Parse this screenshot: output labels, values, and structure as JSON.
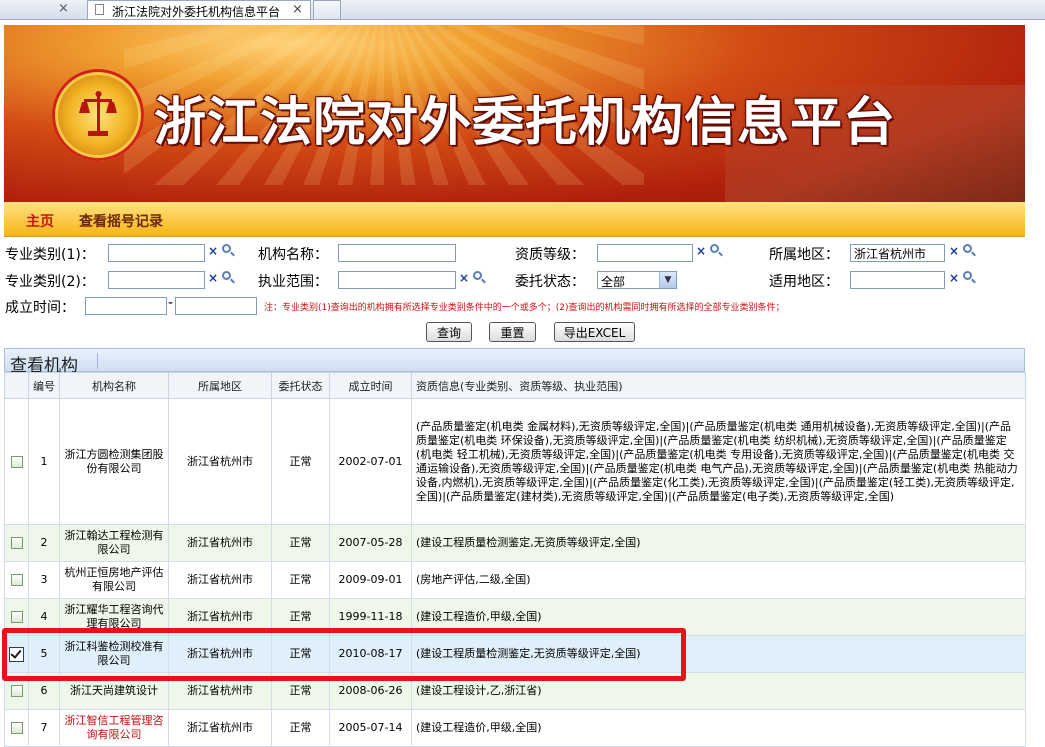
{
  "browser": {
    "tab_title": "浙江法院对外委托机构信息平台",
    "close_glyph": "×"
  },
  "banner": {
    "title": "浙江法院对外委托机构信息平台"
  },
  "nav": {
    "home": "主页",
    "lottery_log": "查看摇号记录"
  },
  "search": {
    "spec1_label": "专业类别(1)：",
    "spec2_label": "专业类别(2)：",
    "founded_label": "成立时间：",
    "founded_dash": "-",
    "name_label": "机构名称：",
    "scope_label": "执业范围：",
    "qual_label": "资质等级：",
    "status_label": "委托状态：",
    "status_value": "全部",
    "region_label": "所属地区：",
    "region_value": "浙江省杭州市",
    "apply_region_label": "适用地区：",
    "clear_glyph": "×",
    "note": "注：专业类别(1)查询出的机构拥有所选择专业类别条件中的一个或多个；(2)查询出的机构需同时拥有所选择的全部专业类别条件；",
    "query_btn": "查询",
    "reset_btn": "重置",
    "export_btn": "导出EXCEL"
  },
  "results": {
    "panel_title": "查看机构",
    "columns": [
      "编号",
      "机构名称",
      "所属地区",
      "委托状态",
      "成立时间",
      "资质信息(专业类别、资质等级、执业范围)"
    ],
    "rows": [
      {
        "no": "1",
        "name": "浙江方圆检测集团股份有限公司",
        "region": "浙江省杭州市",
        "status": "正常",
        "date": "2002-07-01",
        "qual": "(产品质量鉴定(机电类 金属材料),无资质等级评定,全国)|(产品质量鉴定(机电类 通用机械设备),无资质等级评定,全国)|(产品质量鉴定(机电类 环保设备),无资质等级评定,全国)|(产品质量鉴定(机电类 纺织机械),无资质等级评定,全国)|(产品质量鉴定(机电类 轻工机械),无资质等级评定,全国)|(产品质量鉴定(机电类 专用设备),无资质等级评定,全国)|(产品质量鉴定(机电类 交通运输设备),无资质等级评定,全国)|(产品质量鉴定(机电类 电气产品),无资质等级评定,全国)|(产品质量鉴定(机电类 热能动力设备,内燃机),无资质等级评定,全国)|(产品质量鉴定(化工类),无资质等级评定,全国)|(产品质量鉴定(轻工类),无资质等级评定,全国)|(产品质量鉴定(建材类),无资质等级评定,全国)|(产品质量鉴定(电子类),无资质等级评定,全国)"
      },
      {
        "no": "2",
        "name": "浙江翰达工程检测有限公司",
        "region": "浙江省杭州市",
        "status": "正常",
        "date": "2007-05-28",
        "qual": "(建设工程质量检测鉴定,无资质等级评定,全国)"
      },
      {
        "no": "3",
        "name": "杭州正恒房地产评估有限公司",
        "region": "浙江省杭州市",
        "status": "正常",
        "date": "2009-09-01",
        "qual": "(房地产评估,二级,全国)"
      },
      {
        "no": "4",
        "name": "浙江耀华工程咨询代理有限公司",
        "region": "浙江省杭州市",
        "status": "正常",
        "date": "1999-11-18",
        "qual": "(建设工程造价,甲级,全国)"
      },
      {
        "no": "5",
        "name": "浙江科鉴检测校准有限公司",
        "region": "浙江省杭州市",
        "status": "正常",
        "date": "2010-08-17",
        "qual": "(建设工程质量检测鉴定,无资质等级评定,全国)"
      },
      {
        "no": "6",
        "name": "浙江天尚建筑设计",
        "region": "浙江省杭州市",
        "status": "正常",
        "date": "2008-06-26",
        "qual": "(建设工程设计,乙,浙江省)"
      },
      {
        "no": "7",
        "name": "浙江智信工程管理咨询有限公司",
        "region": "浙江省杭州市",
        "status": "正常",
        "date": "2005-07-14",
        "qual": "(建设工程造价,甲级,全国)"
      }
    ]
  },
  "colors": {
    "accent_red": "#c21a0e",
    "highlight": "#e8121a",
    "nav_gold": "#f7b418"
  }
}
